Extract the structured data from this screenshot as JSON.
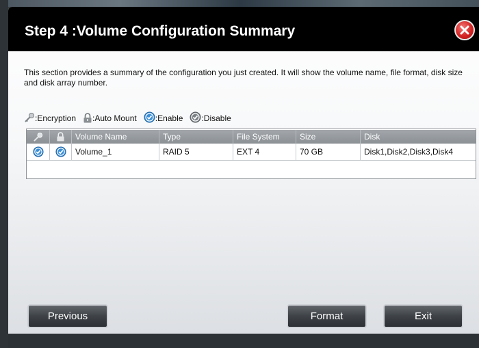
{
  "dialog": {
    "title": "Step 4 :Volume Configuration Summary",
    "description": "This section provides a summary of the configuration you just created. It will show the volume name, file format, disk size and disk array number."
  },
  "legend": {
    "encryption": ":Encryption",
    "auto_mount": ":Auto Mount",
    "enable": ":Enable",
    "disable": ":Disable"
  },
  "table": {
    "headers": [
      "Volume Name",
      "Type",
      "File System",
      "Size",
      "Disk"
    ],
    "rows": [
      {
        "encryption": "enable",
        "auto_mount": "enable",
        "volume_name": "Volume_1",
        "type": "RAID 5",
        "file_system": "EXT 4",
        "size": "70 GB",
        "disk": "Disk1,Disk2,Disk3,Disk4"
      }
    ]
  },
  "buttons": {
    "previous": "Previous",
    "format": "Format",
    "exit": "Exit"
  },
  "colors": {
    "titlebar": "#000000",
    "close_button": "#d42424",
    "enable_icon": "#3d8fd6",
    "button_dark": "#3e4246"
  },
  "icons": {
    "encryption": "key-icon",
    "auto_mount": "padlock-icon",
    "enable": "check-circle-icon",
    "disable": "check-circle-grey-icon",
    "close": "close-icon"
  }
}
